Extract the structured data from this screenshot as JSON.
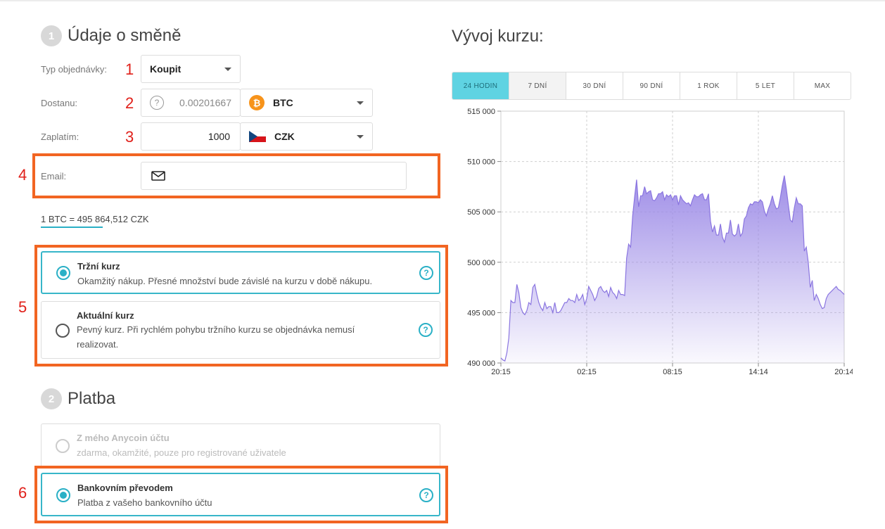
{
  "section1": {
    "number": "1",
    "title": "Údaje o směně"
  },
  "section2": {
    "number": "2",
    "title": "Platba"
  },
  "markers": [
    "1",
    "2",
    "3",
    "4",
    "5",
    "6"
  ],
  "form": {
    "order_type_label": "Typ objednávky:",
    "order_type_value": "Koupit",
    "receive_label": "Dostanu:",
    "receive_amount": "0.00201667",
    "receive_currency": "BTC",
    "pay_label": "Zaplatím:",
    "pay_amount": "1000",
    "pay_currency": "CZK",
    "email_label": "Email:",
    "email_value": "",
    "rate_text": "1 BTC = 495 864,512 CZK"
  },
  "rate_options": [
    {
      "title": "Tržní kurz",
      "desc": "Okamžitý nákup. Přesné množství bude závislé na kurzu v době nákupu.",
      "selected": true
    },
    {
      "title": "Aktuální kurz",
      "desc": "Pevný kurz. Při rychlém pohybu tržního kurzu se objednávka nemusí realizovat.",
      "selected": false
    }
  ],
  "payment_options": [
    {
      "title": "Z mého Anycoin účtu",
      "desc": "zdarma, okamžité, pouze pro registrované uživatele",
      "enabled": false
    },
    {
      "title": "Bankovním převodem",
      "desc": "Platba z vašeho bankovního účtu",
      "enabled": true,
      "selected": true
    }
  ],
  "colors": {
    "accent": "#2ab0c6",
    "highlight": "#f26522",
    "marker": "#e0201a",
    "chart_line": "#8a75e0",
    "btc": "#f7931a"
  },
  "icons": {
    "help": "?",
    "help_icon": "question-circle-icon",
    "email_icon": "envelope-icon"
  },
  "chart": {
    "title": "Vývoj kurzu:",
    "tabs": [
      "24 HODIN",
      "7 DNÍ",
      "30 DNÍ",
      "90 DNÍ",
      "1 ROK",
      "5 LET",
      "MAX"
    ],
    "active_tab": 0
  },
  "chart_data": {
    "type": "area",
    "title": "",
    "xlabel": "",
    "ylabel": "",
    "x_ticks": [
      "20:15",
      "02:15",
      "08:15",
      "14:14",
      "20:14"
    ],
    "y_ticks": [
      "490 000",
      "495 000",
      "500 000",
      "505 000",
      "510 000",
      "515 000"
    ],
    "ylim": [
      490000,
      515000
    ],
    "grid": true,
    "series": [
      {
        "values": [
          490500,
          490300,
          490200,
          491000,
          492500,
          496200,
          496000,
          496000,
          497800,
          497000,
          495500,
          495000,
          494800,
          495200,
          496000,
          495800,
          497500,
          497800,
          496800,
          496000,
          495500,
          495200,
          496000,
          495400,
          495600,
          495600,
          495000,
          496000,
          495000,
          495000,
          495200,
          495600,
          496000,
          496000,
          496400,
          496200,
          496200,
          496000,
          496800,
          496200,
          496400,
          496800,
          495800,
          496400,
          497600,
          497200,
          496800,
          496200,
          496600,
          497400,
          497600,
          497200,
          497000,
          497200,
          496600,
          497500,
          497000,
          496800,
          496400,
          497200,
          496800,
          496800,
          496700,
          500400,
          501800,
          501500,
          504600,
          506500,
          508200,
          505500,
          506600,
          506600,
          507500,
          506800,
          507000,
          507100,
          506200,
          506100,
          506400,
          506800,
          506800,
          507000,
          506200,
          506700,
          506500,
          506700,
          506200,
          506600,
          506600,
          505700,
          506600,
          506200,
          506000,
          505800,
          505900,
          505600,
          506200,
          506700,
          506500,
          506500,
          506700,
          506800,
          506200,
          506200,
          506800,
          504100,
          503000,
          503600,
          502700,
          502700,
          503800,
          502500,
          502000,
          502900,
          502900,
          504200,
          502800,
          502600,
          502800,
          503800,
          502600,
          502900,
          504300,
          504600,
          505400,
          505800,
          505700,
          506000,
          506000,
          505900,
          506200,
          506000,
          505100,
          504600,
          505300,
          505800,
          506600,
          505800,
          505300,
          505400,
          506400,
          507600,
          508600,
          507300,
          505700,
          504200,
          504000,
          505400,
          506400,
          505800,
          505800,
          505600,
          501100,
          501500,
          500000,
          497500,
          498200,
          496200,
          496800,
          496400,
          495800,
          495400,
          495500,
          496400,
          496800,
          497000,
          497200,
          497400,
          497600,
          497300,
          497200,
          497000,
          496800
        ]
      }
    ]
  }
}
